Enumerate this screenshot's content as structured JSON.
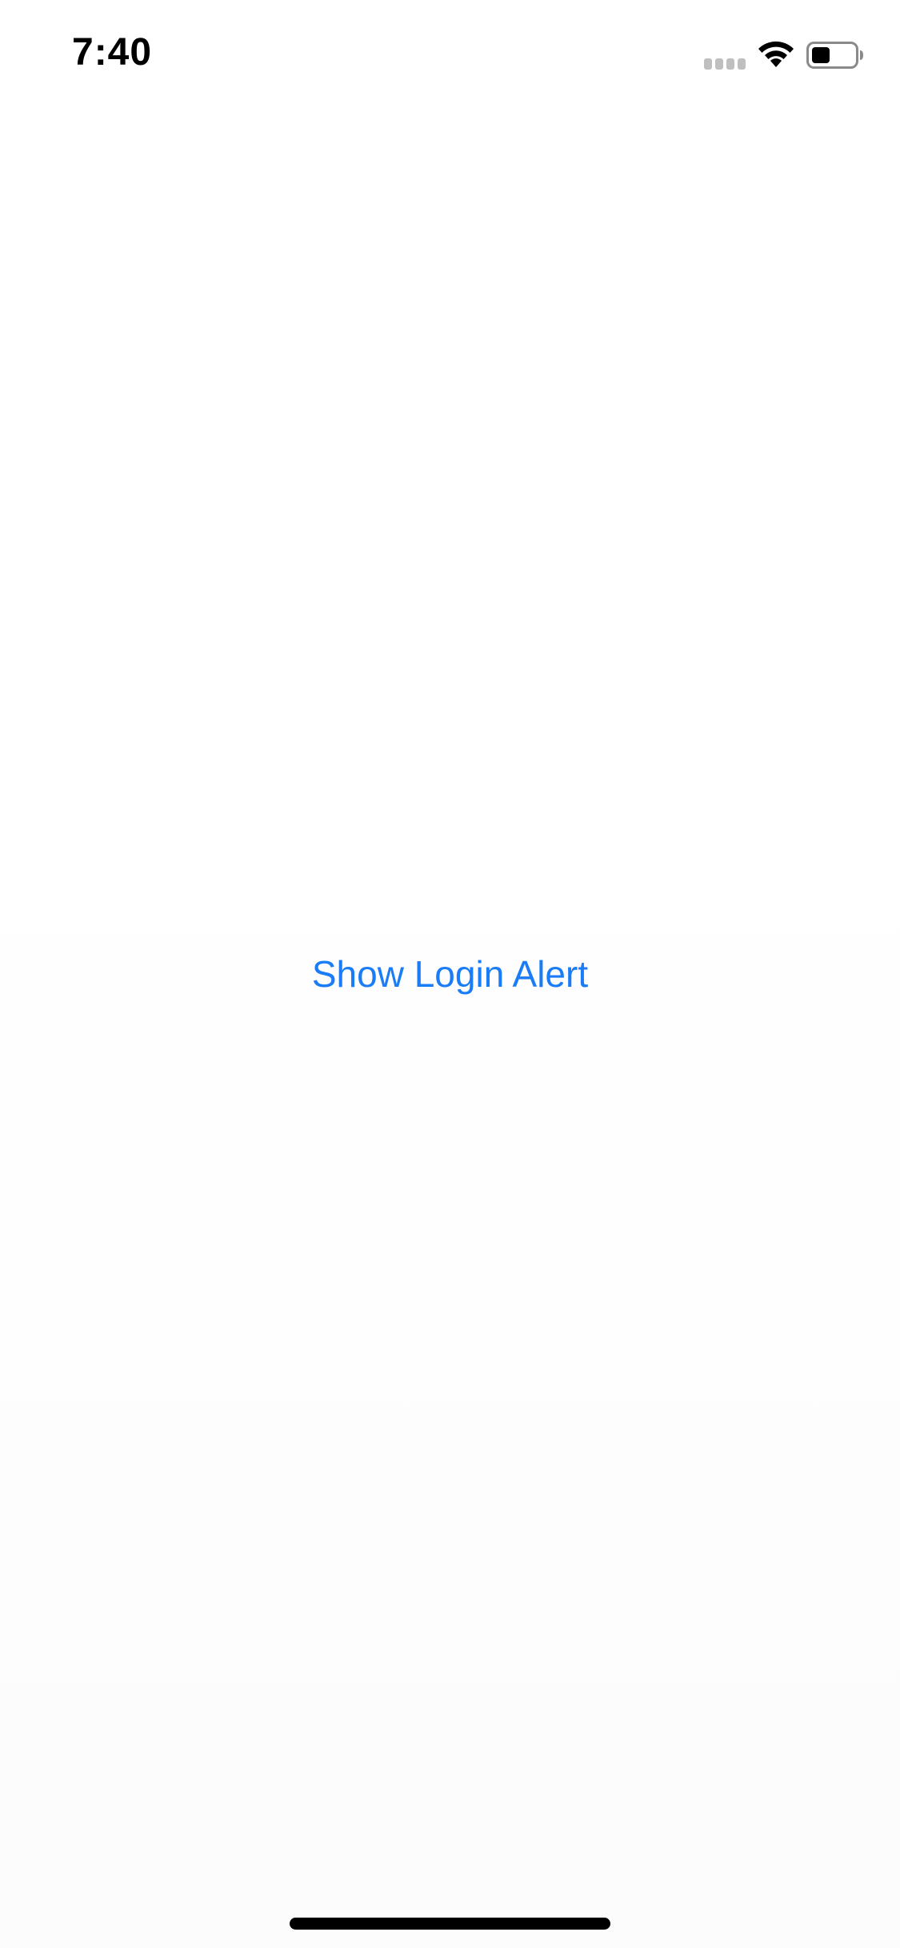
{
  "status_bar": {
    "time": "7:40",
    "cellular_icon": "cellular-signal-icon",
    "wifi_icon": "wifi-icon",
    "battery_icon": "battery-icon"
  },
  "main": {
    "button_label": "Show Login Alert"
  },
  "colors": {
    "accent": "#1a7cf6",
    "text": "#000000",
    "background": "#ffffff",
    "signal_inactive": "#bfbfbf"
  }
}
